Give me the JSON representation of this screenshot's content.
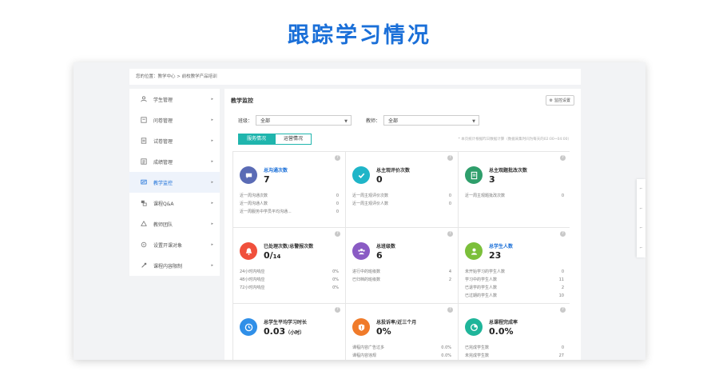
{
  "title": "跟踪学习情况",
  "breadcrumb": "您的位置：教学中心 > 前校教学产品培训",
  "sidebar": {
    "items": [
      {
        "label": "学生管理",
        "icon": "user-icon",
        "active": false
      },
      {
        "label": "问卷管理",
        "icon": "survey-icon",
        "active": false
      },
      {
        "label": "试卷管理",
        "icon": "exam-icon",
        "active": false
      },
      {
        "label": "成绩管理",
        "icon": "grade-icon",
        "active": false
      },
      {
        "label": "教学监控",
        "icon": "monitor-icon",
        "active": true
      },
      {
        "label": "课程Q&A",
        "icon": "qa-icon",
        "active": false
      },
      {
        "label": "教师团队",
        "icon": "team-icon",
        "active": false
      },
      {
        "label": "设置开课对象",
        "icon": "settings-icon",
        "active": false
      },
      {
        "label": "课程内容限制",
        "icon": "restrict-icon",
        "active": false
      }
    ],
    "arrow": "▸"
  },
  "main": {
    "heading": "教学监控",
    "monitor_button": "监控设置",
    "class_filter": {
      "label": "班级：",
      "value": "全部"
    },
    "teacher_filter": {
      "label": "教师：",
      "value": "全部"
    },
    "tabs": [
      {
        "label": "服务情况",
        "active": true
      },
      {
        "label": "运营情况",
        "active": false
      }
    ],
    "note": "* 本页统计根据昨日数据计算（数据采集时间为每天的02:00~04:00）"
  },
  "cards": [
    {
      "name": "总沟通次数",
      "link": true,
      "value": "7",
      "denom": "",
      "unit": "",
      "color": "#5a6bb5",
      "icon": "chat-icon",
      "rows": [
        [
          "近一周沟通次数",
          "0"
        ],
        [
          "近一周沟通人数",
          "0"
        ],
        [
          "近一周服务中学员平均沟通...",
          "0"
        ]
      ]
    },
    {
      "name": "总主观评价次数",
      "link": false,
      "value": "0",
      "denom": "",
      "unit": "",
      "color": "#1fb5c8",
      "icon": "check-icon",
      "rows": [
        [
          "近一周主观评价次数",
          "0"
        ],
        [
          "近一周主观评价人数",
          "0"
        ]
      ]
    },
    {
      "name": "总主观题批改次数",
      "link": false,
      "value": "3",
      "denom": "",
      "unit": "",
      "color": "#2e9e6b",
      "icon": "doc-icon",
      "rows": [
        [
          "近一周主观题批改次数",
          "0"
        ]
      ]
    },
    {
      "name": "已处理次数/总警报次数",
      "link": false,
      "value": "0/",
      "denom": "14",
      "unit": "",
      "color": "#f0503c",
      "icon": "bell-icon",
      "rows": [
        [
          "24小时内响应",
          "0%"
        ],
        [
          "48小时内响应",
          "0%"
        ],
        [
          "72小时内响应",
          "0%"
        ]
      ]
    },
    {
      "name": "总班级数",
      "link": false,
      "value": "6",
      "denom": "",
      "unit": "",
      "color": "#8a5bc4",
      "icon": "group-icon",
      "rows": [
        [
          "进行中的班级数",
          "4"
        ],
        [
          "已归档的班级数",
          "2"
        ]
      ]
    },
    {
      "name": "总学生人数",
      "link": true,
      "value": "23",
      "denom": "",
      "unit": "",
      "color": "#7bbf3a",
      "icon": "person-icon",
      "rows": [
        [
          "未开始学习的学生人数",
          "0"
        ],
        [
          "学习中的学生人数",
          "11"
        ],
        [
          "已退学的学生人数",
          "2"
        ],
        [
          "已过期的学生人数",
          "10"
        ]
      ]
    },
    {
      "name": "总学生平均学习时长",
      "link": false,
      "value": "0.03",
      "denom": "",
      "unit": "（小时）",
      "color": "#2f8fe8",
      "icon": "clock-icon",
      "rows": []
    },
    {
      "name": "总投诉率/近三个月",
      "link": false,
      "value": "0%",
      "denom": "",
      "unit": "",
      "color": "#f07b2a",
      "icon": "warning-icon",
      "rows": [
        [
          "课程内容广告过多",
          "0.0%"
        ],
        [
          "课程内容违规",
          "0.0%"
        ]
      ]
    },
    {
      "name": "总课程完成率",
      "link": false,
      "value": "0.0%",
      "denom": "",
      "unit": "",
      "color": "#1fb59a",
      "icon": "pie-icon",
      "rows": [
        [
          "已完成学生数",
          "0"
        ],
        [
          "未完成学生数",
          "27"
        ]
      ]
    }
  ],
  "help_glyph": "?"
}
